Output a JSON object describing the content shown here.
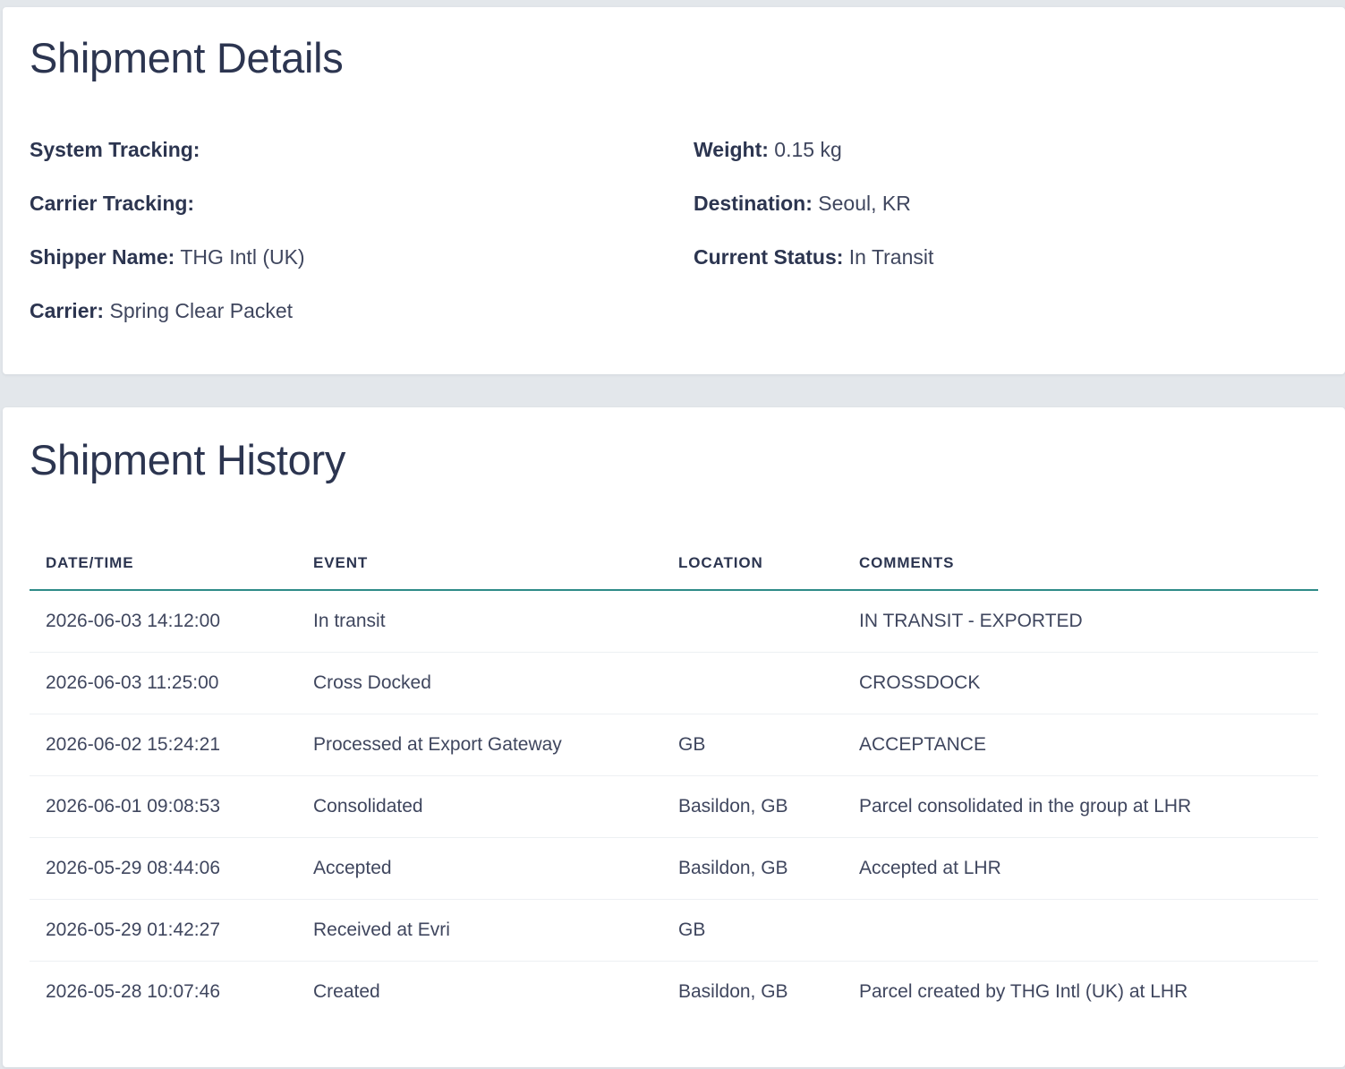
{
  "details": {
    "title": "Shipment Details",
    "system_tracking": {
      "label": "System Tracking:",
      "value": ""
    },
    "carrier_tracking": {
      "label": "Carrier Tracking:",
      "value": ""
    },
    "shipper_name": {
      "label": "Shipper Name:",
      "value": "THG Intl (UK)"
    },
    "carrier": {
      "label": "Carrier:",
      "value": "Spring Clear Packet"
    },
    "weight": {
      "label": "Weight:",
      "value": "0.15 kg"
    },
    "destination": {
      "label": "Destination:",
      "value": "Seoul, KR"
    },
    "current_status": {
      "label": "Current Status:",
      "value": "In Transit"
    }
  },
  "history": {
    "title": "Shipment History",
    "columns": {
      "datetime": "DATE/TIME",
      "event": "EVENT",
      "location": "LOCATION",
      "comments": "COMMENTS"
    },
    "rows": [
      {
        "datetime": "2026-06-03 14:12:00",
        "event": "In transit",
        "location": "",
        "comments": "IN TRANSIT - EXPORTED"
      },
      {
        "datetime": "2026-06-03 11:25:00",
        "event": "Cross Docked",
        "location": "",
        "comments": "CROSSDOCK"
      },
      {
        "datetime": "2026-06-02 15:24:21",
        "event": "Processed at Export Gateway",
        "location": "GB",
        "comments": "ACCEPTANCE"
      },
      {
        "datetime": "2026-06-01 09:08:53",
        "event": "Consolidated",
        "location": "Basildon, GB",
        "comments": "Parcel consolidated in the group at LHR"
      },
      {
        "datetime": "2026-05-29 08:44:06",
        "event": "Accepted",
        "location": "Basildon, GB",
        "comments": "Accepted at LHR"
      },
      {
        "datetime": "2026-05-29 01:42:27",
        "event": "Received at Evri",
        "location": "GB",
        "comments": ""
      },
      {
        "datetime": "2026-05-28 10:07:46",
        "event": "Created",
        "location": "Basildon, GB",
        "comments": "Parcel created by THG Intl (UK) at LHR"
      }
    ]
  },
  "colors": {
    "page_background": "#e3e7eb",
    "card_background": "#ffffff",
    "text_primary": "#2c3550",
    "header_divider": "#2e8b88"
  }
}
